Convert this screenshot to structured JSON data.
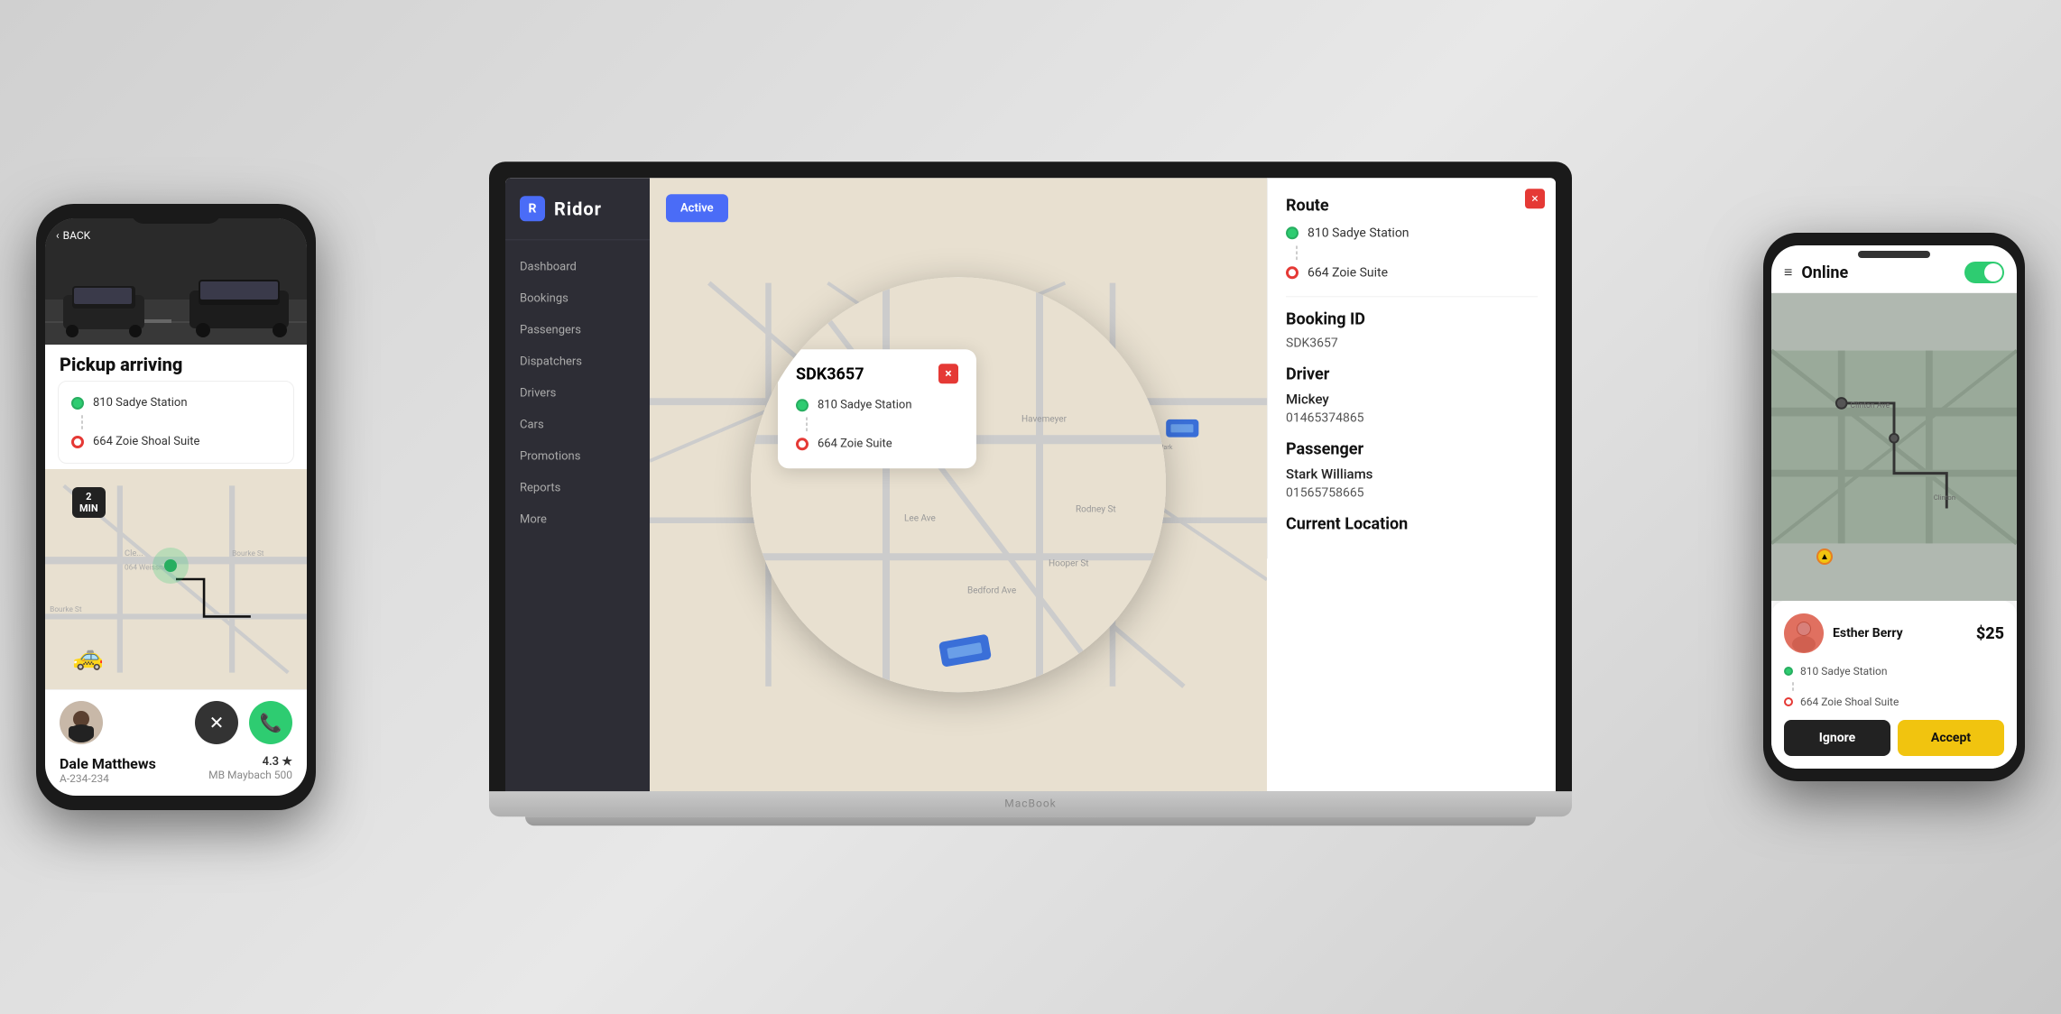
{
  "scene": {
    "background": "#d8d8d8"
  },
  "laptop": {
    "brand": "MacBook",
    "sidebar": {
      "logo": "Ridor",
      "items": [
        {
          "label": "Dashboard"
        },
        {
          "label": "Bookings"
        },
        {
          "label": "Passengers"
        },
        {
          "label": "Dispatchers"
        },
        {
          "label": "Drivers"
        },
        {
          "label": "Cars"
        },
        {
          "label": "Promotions"
        },
        {
          "label": "Reports"
        },
        {
          "label": "More"
        }
      ]
    },
    "map_button": "Active",
    "booking_popup": {
      "id": "SDK3657",
      "pickup": "810 Sadye Station",
      "dropoff": "664 Zoie Suite",
      "close_label": "×"
    },
    "detail_panel": {
      "route_title": "Route",
      "pickup": "810 Sadye Station",
      "dropoff": "664 Zoie Suite",
      "booking_id_title": "Booking ID",
      "booking_id": "SDK3657",
      "driver_title": "Driver",
      "driver_name": "Mickey",
      "driver_phone": "01465374865",
      "passenger_title": "Passenger",
      "passenger_name": "Stark Williams",
      "passenger_phone": "01565758665",
      "location_title": "Current Location",
      "close_label": "×"
    }
  },
  "phone_left": {
    "back_label": "BACK",
    "title": "Pickup arriving",
    "pickup": "810 Sadye Station",
    "dropoff": "664 Zoie Shoal Suite",
    "min_badge": "2\nMIN",
    "driver_name": "Dale Matthews",
    "driver_id": "A-234-234",
    "driver_rating": "4.3 ★",
    "driver_car": "MB Maybach 500",
    "cancel_icon": "✕",
    "call_icon": "📞"
  },
  "phone_right": {
    "status": "Online",
    "toggle_on": true,
    "passenger_name": "Esther Berry",
    "fare": "$25",
    "pickup": "810 Sadye Station",
    "dropoff": "664 Zoie Shoal Suite",
    "ignore_label": "Ignore",
    "accept_label": "Accept"
  }
}
